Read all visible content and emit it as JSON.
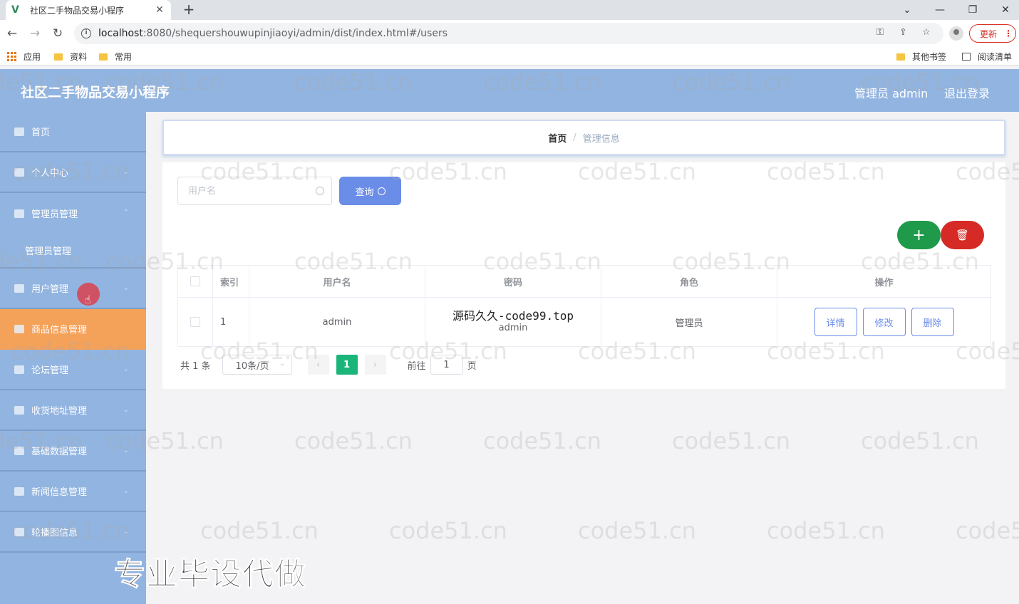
{
  "browser": {
    "tab_title": "社区二手物品交易小程序",
    "url_host": "localhost",
    "url_rest": ":8080/shequershouwupinjiaoyi/admin/dist/index.html#/users",
    "update_label": "更新",
    "bookmarks": [
      "应用",
      "资料",
      "常用"
    ],
    "bookmarks_right": [
      "其他书签",
      "阅读清单"
    ]
  },
  "header": {
    "title": "社区二手物品交易小程序",
    "user": "管理员 admin",
    "logout": "退出登录"
  },
  "sidebar": {
    "items": [
      {
        "label": "首页"
      },
      {
        "label": "个人中心"
      },
      {
        "label": "管理员管理"
      },
      {
        "label": "用户管理"
      },
      {
        "label": "商品信息管理"
      },
      {
        "label": "论坛管理"
      },
      {
        "label": "收货地址管理"
      },
      {
        "label": "基础数据管理"
      },
      {
        "label": "新闻信息管理"
      },
      {
        "label": "轮播图信息"
      }
    ],
    "submenu": "管理员管理"
  },
  "breadcrumb": {
    "home": "首页",
    "separator": "/",
    "current": "管理信息"
  },
  "search": {
    "placeholder": "用户名",
    "button": "查询"
  },
  "actions": {
    "add": "+",
    "delete": "🗑"
  },
  "table": {
    "headers": [
      "索引",
      "用户名",
      "密码",
      "角色",
      "操作"
    ],
    "rows": [
      {
        "index": "1",
        "username": "admin",
        "password": "admin",
        "role": "管理员"
      }
    ],
    "row_actions": [
      "详情",
      "修改",
      "删除"
    ],
    "overlay_text": "源码久久-code99.top"
  },
  "pagination": {
    "total": "共 1 条",
    "page_size": "10条/页",
    "current_page": "1",
    "goto_label": "前往",
    "goto_value": "1",
    "page_suffix": "页"
  },
  "watermark": "code51.cn",
  "promo": "专业毕设代做",
  "colors": {
    "header": "#92b4e0",
    "active_menu": "#f4a15a",
    "primary": "#6a8de8",
    "add": "#1e9a4a",
    "danger": "#d62a26",
    "page_active": "#1bb57a"
  }
}
